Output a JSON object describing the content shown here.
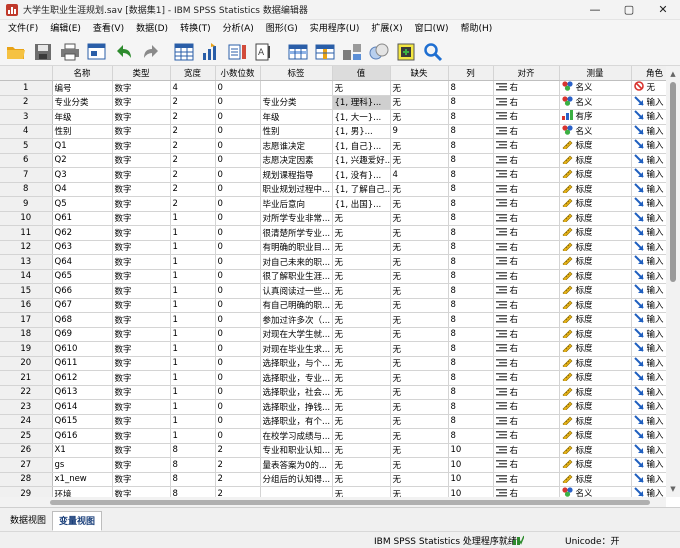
{
  "window": {
    "title": "大学生职业生涯规划.sav [数据集1] - IBM SPSS Statistics 数据编辑器",
    "minimize": "—",
    "maximize": "▢",
    "close": "✕"
  },
  "menu": [
    "文件(F)",
    "编辑(E)",
    "查看(V)",
    "数据(D)",
    "转换(T)",
    "分析(A)",
    "图形(G)",
    "实用程序(U)",
    "扩展(X)",
    "窗口(W)",
    "帮助(H)"
  ],
  "toolbar": [
    "open-folder-icon",
    "save-icon",
    "print-icon",
    "dialog-recall-icon",
    "undo-icon",
    "redo-icon",
    "goto-case-icon",
    "goto-variable-icon",
    "variables-icon",
    "find-icon",
    "insert-cases-icon",
    "insert-variable-icon",
    "split-file-icon",
    "weight-cases-icon",
    "select-cases-icon",
    "value-labels-icon",
    "search-icon"
  ],
  "columns": [
    "",
    "名称",
    "类型",
    "宽度",
    "小数位数",
    "标签",
    "值",
    "缺失",
    "列",
    "对齐",
    "测量",
    "角色"
  ],
  "icons": {
    "align": "align-right-icon",
    "nominal": "nominal-measure-icon",
    "ordinal": "ordinal-measure-icon",
    "scale": "scale-measure-icon",
    "input": "input-role-icon",
    "none": "none-role-icon"
  },
  "rows": [
    {
      "n": "1",
      "name": "编号",
      "type": "数字",
      "width": "4",
      "dec": "0",
      "label": "",
      "values": "无",
      "missing": "无",
      "col": "8",
      "align": "右",
      "measure": "名义",
      "mtype": "nominal",
      "role": "无",
      "rtype": "none"
    },
    {
      "n": "2",
      "name": "专业分类",
      "type": "数字",
      "width": "2",
      "dec": "0",
      "label": "专业分类",
      "values": "{1, 理科}...",
      "missing": "无",
      "col": "8",
      "align": "右",
      "measure": "名义",
      "mtype": "nominal",
      "role": "输入",
      "rtype": "input"
    },
    {
      "n": "3",
      "name": "年级",
      "type": "数字",
      "width": "2",
      "dec": "0",
      "label": "年级",
      "values": "{1, 大一}...",
      "missing": "无",
      "col": "8",
      "align": "右",
      "measure": "有序",
      "mtype": "ordinal",
      "role": "输入",
      "rtype": "input"
    },
    {
      "n": "4",
      "name": "性别",
      "type": "数字",
      "width": "2",
      "dec": "0",
      "label": "性别",
      "values": "{1, 男}...",
      "missing": "9",
      "col": "8",
      "align": "右",
      "measure": "名义",
      "mtype": "nominal",
      "role": "输入",
      "rtype": "input"
    },
    {
      "n": "5",
      "name": "Q1",
      "type": "数字",
      "width": "2",
      "dec": "0",
      "label": "志愿谁决定",
      "values": "{1, 自己}...",
      "missing": "无",
      "col": "8",
      "align": "右",
      "measure": "标度",
      "mtype": "scale",
      "role": "输入",
      "rtype": "input"
    },
    {
      "n": "6",
      "name": "Q2",
      "type": "数字",
      "width": "2",
      "dec": "0",
      "label": "志愿决定因素",
      "values": "{1, 兴趣爱好...",
      "missing": "无",
      "col": "8",
      "align": "右",
      "measure": "标度",
      "mtype": "scale",
      "role": "输入",
      "rtype": "input"
    },
    {
      "n": "7",
      "name": "Q3",
      "type": "数字",
      "width": "2",
      "dec": "0",
      "label": "规划课程指导",
      "values": "{1, 没有}...",
      "missing": "4",
      "col": "8",
      "align": "右",
      "measure": "标度",
      "mtype": "scale",
      "role": "输入",
      "rtype": "input"
    },
    {
      "n": "8",
      "name": "Q4",
      "type": "数字",
      "width": "2",
      "dec": "0",
      "label": "职业规划过程中...",
      "values": "{1, 了解自己...",
      "missing": "无",
      "col": "8",
      "align": "右",
      "measure": "标度",
      "mtype": "scale",
      "role": "输入",
      "rtype": "input"
    },
    {
      "n": "9",
      "name": "Q5",
      "type": "数字",
      "width": "2",
      "dec": "0",
      "label": "毕业后意向",
      "values": "{1, 出国}...",
      "missing": "无",
      "col": "8",
      "align": "右",
      "measure": "标度",
      "mtype": "scale",
      "role": "输入",
      "rtype": "input"
    },
    {
      "n": "10",
      "name": "Q61",
      "type": "数字",
      "width": "1",
      "dec": "0",
      "label": "对所学专业非常...",
      "values": "无",
      "missing": "无",
      "col": "8",
      "align": "右",
      "measure": "标度",
      "mtype": "scale",
      "role": "输入",
      "rtype": "input"
    },
    {
      "n": "11",
      "name": "Q62",
      "type": "数字",
      "width": "1",
      "dec": "0",
      "label": "很清楚所学专业...",
      "values": "无",
      "missing": "无",
      "col": "8",
      "align": "右",
      "measure": "标度",
      "mtype": "scale",
      "role": "输入",
      "rtype": "input"
    },
    {
      "n": "12",
      "name": "Q63",
      "type": "数字",
      "width": "1",
      "dec": "0",
      "label": "有明确的职业目...",
      "values": "无",
      "missing": "无",
      "col": "8",
      "align": "右",
      "measure": "标度",
      "mtype": "scale",
      "role": "输入",
      "rtype": "input"
    },
    {
      "n": "13",
      "name": "Q64",
      "type": "数字",
      "width": "1",
      "dec": "0",
      "label": "对自己未来的职...",
      "values": "无",
      "missing": "无",
      "col": "8",
      "align": "右",
      "measure": "标度",
      "mtype": "scale",
      "role": "输入",
      "rtype": "input"
    },
    {
      "n": "14",
      "name": "Q65",
      "type": "数字",
      "width": "1",
      "dec": "0",
      "label": "很了解职业生涯...",
      "values": "无",
      "missing": "无",
      "col": "8",
      "align": "右",
      "measure": "标度",
      "mtype": "scale",
      "role": "输入",
      "rtype": "input"
    },
    {
      "n": "15",
      "name": "Q66",
      "type": "数字",
      "width": "1",
      "dec": "0",
      "label": "认真阅读过一些...",
      "values": "无",
      "missing": "无",
      "col": "8",
      "align": "右",
      "measure": "标度",
      "mtype": "scale",
      "role": "输入",
      "rtype": "input"
    },
    {
      "n": "16",
      "name": "Q67",
      "type": "数字",
      "width": "1",
      "dec": "0",
      "label": "有自己明确的职...",
      "values": "无",
      "missing": "无",
      "col": "8",
      "align": "右",
      "measure": "标度",
      "mtype": "scale",
      "role": "输入",
      "rtype": "input"
    },
    {
      "n": "17",
      "name": "Q68",
      "type": "数字",
      "width": "1",
      "dec": "0",
      "label": "参加过许多次（...",
      "values": "无",
      "missing": "无",
      "col": "8",
      "align": "右",
      "measure": "标度",
      "mtype": "scale",
      "role": "输入",
      "rtype": "input"
    },
    {
      "n": "18",
      "name": "Q69",
      "type": "数字",
      "width": "1",
      "dec": "0",
      "label": "对现在大学生就...",
      "values": "无",
      "missing": "无",
      "col": "8",
      "align": "右",
      "measure": "标度",
      "mtype": "scale",
      "role": "输入",
      "rtype": "input"
    },
    {
      "n": "19",
      "name": "Q610",
      "type": "数字",
      "width": "1",
      "dec": "0",
      "label": "对现在毕业生求...",
      "values": "无",
      "missing": "无",
      "col": "8",
      "align": "右",
      "measure": "标度",
      "mtype": "scale",
      "role": "输入",
      "rtype": "input"
    },
    {
      "n": "20",
      "name": "Q611",
      "type": "数字",
      "width": "1",
      "dec": "0",
      "label": "选择职业，与个...",
      "values": "无",
      "missing": "无",
      "col": "8",
      "align": "右",
      "measure": "标度",
      "mtype": "scale",
      "role": "输入",
      "rtype": "input"
    },
    {
      "n": "21",
      "name": "Q612",
      "type": "数字",
      "width": "1",
      "dec": "0",
      "label": "选择职业，专业...",
      "values": "无",
      "missing": "无",
      "col": "8",
      "align": "右",
      "measure": "标度",
      "mtype": "scale",
      "role": "输入",
      "rtype": "input"
    },
    {
      "n": "22",
      "name": "Q613",
      "type": "数字",
      "width": "1",
      "dec": "0",
      "label": "选择职业，社会...",
      "values": "无",
      "missing": "无",
      "col": "8",
      "align": "右",
      "measure": "标度",
      "mtype": "scale",
      "role": "输入",
      "rtype": "input"
    },
    {
      "n": "23",
      "name": "Q614",
      "type": "数字",
      "width": "1",
      "dec": "0",
      "label": "选择职业，挣钱...",
      "values": "无",
      "missing": "无",
      "col": "8",
      "align": "右",
      "measure": "标度",
      "mtype": "scale",
      "role": "输入",
      "rtype": "input"
    },
    {
      "n": "24",
      "name": "Q615",
      "type": "数字",
      "width": "1",
      "dec": "0",
      "label": "选择职业，有个...",
      "values": "无",
      "missing": "无",
      "col": "8",
      "align": "右",
      "measure": "标度",
      "mtype": "scale",
      "role": "输入",
      "rtype": "input"
    },
    {
      "n": "25",
      "name": "Q616",
      "type": "数字",
      "width": "1",
      "dec": "0",
      "label": "在校学习成绩与...",
      "values": "无",
      "missing": "无",
      "col": "8",
      "align": "右",
      "measure": "标度",
      "mtype": "scale",
      "role": "输入",
      "rtype": "input"
    },
    {
      "n": "26",
      "name": "X1",
      "type": "数字",
      "width": "8",
      "dec": "2",
      "label": "专业和职业认知...",
      "values": "无",
      "missing": "无",
      "col": "10",
      "align": "右",
      "measure": "标度",
      "mtype": "scale",
      "role": "输入",
      "rtype": "input"
    },
    {
      "n": "27",
      "name": "gs",
      "type": "数字",
      "width": "8",
      "dec": "2",
      "label": "量表答案为0的...",
      "values": "无",
      "missing": "无",
      "col": "10",
      "align": "右",
      "measure": "标度",
      "mtype": "scale",
      "role": "输入",
      "rtype": "input"
    },
    {
      "n": "28",
      "name": "x1_new",
      "type": "数字",
      "width": "8",
      "dec": "2",
      "label": "分组后的认知得...",
      "values": "无",
      "missing": "无",
      "col": "10",
      "align": "右",
      "measure": "标度",
      "mtype": "scale",
      "role": "输入",
      "rtype": "input"
    },
    {
      "n": "29",
      "name": "环境",
      "type": "数字",
      "width": "8",
      "dec": "2",
      "label": "",
      "values": "无",
      "missing": "无",
      "col": "10",
      "align": "右",
      "measure": "名义",
      "mtype": "nominal",
      "role": "输入",
      "rtype": "input"
    }
  ],
  "tabs": [
    "数据视图",
    "变量视图"
  ],
  "active_tab": "变量视图",
  "status": {
    "message": "IBM SPSS Statistics 处理程序就绪",
    "unicode": "Unicode：开"
  },
  "colors": {
    "accent": "#1a3f7a",
    "header_bg": "#f0f0f0",
    "grid_line": "#d4d4d4"
  }
}
